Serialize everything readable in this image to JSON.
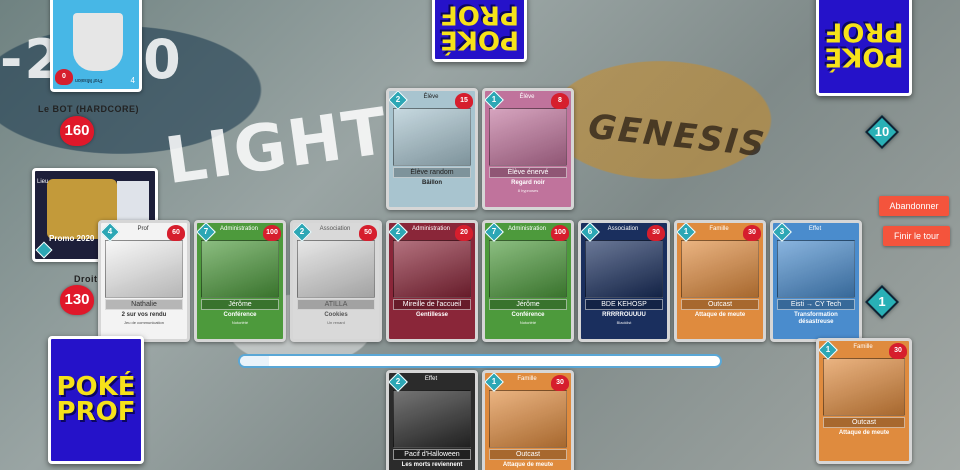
{
  "opponent": {
    "name": "Le BOT (HARDCORE)",
    "hp": "160",
    "mana": "10",
    "deck_label": "POKÉ PROF"
  },
  "player": {
    "name": "Droit",
    "hp": "130",
    "mana": "1",
    "deck_label": "POKÉ PROF"
  },
  "buttons": {
    "surrender": "Abandonner",
    "end_turn": "Finir le tour"
  },
  "background": {
    "light": "LIGHT",
    "genesis": "GENESIS",
    "year": "-2020"
  },
  "turn_timer": {
    "fraction": 0.06
  },
  "opponent_played_card": {
    "name": "Etudiante",
    "hp": "9",
    "cost": "4"
  },
  "hero_card_opponent": {
    "text": "Prof Mission",
    "cost": "4",
    "hp": "0"
  },
  "hero_card_player": {
    "label": "Lieu",
    "name": "Promo 2020",
    "hp": "4",
    "cost": "4"
  },
  "opponent_board": [
    {
      "type": "Élève",
      "name": "Élève random",
      "ability": "Bâillon",
      "desc": "",
      "cost": "2",
      "hp": "15",
      "atk": "13",
      "color": "c-lightblue"
    },
    {
      "type": "Élève",
      "name": "Élève énervé",
      "ability": "Regard noir",
      "desc": "8 hypnoses",
      "cost": "1",
      "hp": "8",
      "atk": "6",
      "color": "c-pink"
    }
  ],
  "player_board": [
    {
      "type": "Prof",
      "name": "Nathalie",
      "ability": "2 sur vos rendu",
      "desc": "Jeu de communication",
      "cost": "4",
      "hp": "60",
      "atk": "10",
      "color": "c-white"
    },
    {
      "type": "Administration",
      "name": "Jérôme",
      "ability": "Conférence",
      "desc": "Notoriété",
      "cost": "7",
      "hp": "100",
      "atk": "80",
      "color": "c-green"
    },
    {
      "type": "Association",
      "name": "ATILLA",
      "ability": "Cookies",
      "desc": "Un renard",
      "cost": "2",
      "hp": "50",
      "atk": "",
      "color": "c-gray"
    },
    {
      "type": "Administration",
      "name": "Mireille de l'accueil",
      "ability": "Gentillesse",
      "desc": "",
      "cost": "2",
      "hp": "20",
      "atk": "",
      "color": "c-red"
    },
    {
      "type": "Administration",
      "name": "Jérôme",
      "ability": "Conférence",
      "desc": "Notoriété",
      "cost": "7",
      "hp": "100",
      "atk": "",
      "color": "c-green"
    },
    {
      "type": "Association",
      "name": "BDE KEHOSP",
      "ability": "RRRRROUUUU",
      "desc": "Blacklist",
      "cost": "6",
      "hp": "30",
      "atk": "",
      "color": "c-navy"
    },
    {
      "type": "Famille",
      "name": "Outcast",
      "ability": "Attaque de meute",
      "desc": "",
      "cost": "1",
      "hp": "30",
      "atk": "",
      "color": "c-orange"
    },
    {
      "type": "Effet",
      "name": "Eisti → CY Tech",
      "ability": "Transformation désastreuse",
      "desc": "",
      "cost": "3",
      "hp": "",
      "atk": "",
      "color": "c-blue"
    }
  ],
  "hand": [
    {
      "type": "Effet",
      "name": "Pacif d'Halloween",
      "ability": "Les morts reviennent",
      "cost": "2",
      "hp": "",
      "color": "c-dark"
    },
    {
      "type": "Famille",
      "name": "Outcast",
      "ability": "Attaque de meute",
      "cost": "1",
      "hp": "30",
      "color": "c-orange"
    }
  ],
  "selected_card": {
    "type": "Famille",
    "name": "Outcast",
    "ability": "Attaque de meute",
    "cost": "1",
    "hp": "30",
    "color": "c-orange"
  }
}
